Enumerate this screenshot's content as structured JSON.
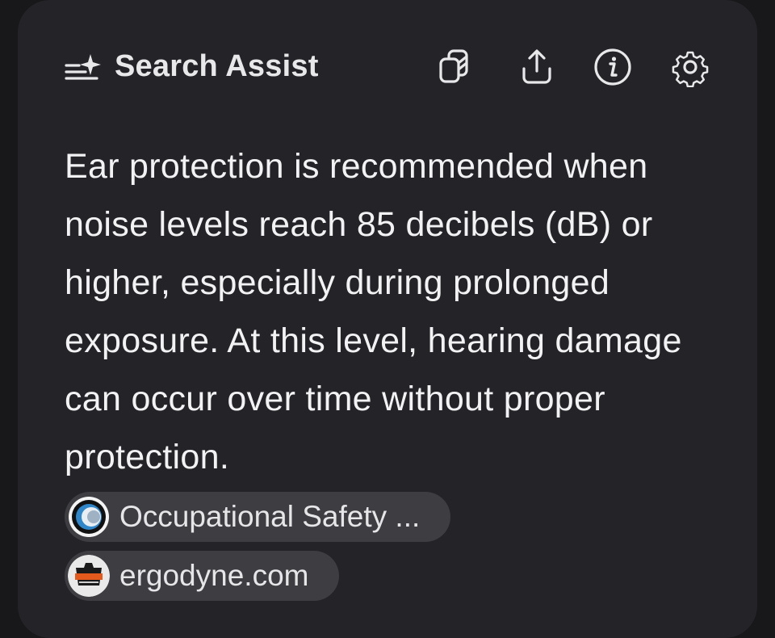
{
  "header": {
    "title": "Search Assist",
    "brand_icon": "sparkle-lines-icon",
    "actions": [
      {
        "name": "copy",
        "icon": "copy-icon"
      },
      {
        "name": "share",
        "icon": "share-icon"
      },
      {
        "name": "info",
        "icon": "info-icon"
      },
      {
        "name": "settings",
        "icon": "gear-icon"
      }
    ]
  },
  "answer": {
    "text": "Ear protection is recommended when noise levels reach 85 decibels (dB) or higher, especially during prolonged exposure. At this level, hearing damage can occur over time without proper protection."
  },
  "sources": [
    {
      "label": "Occupational Safety ...",
      "icon": "osha-logo-icon"
    },
    {
      "label": "ergodyne.com",
      "icon": "ergodyne-logo-icon"
    }
  ],
  "colors": {
    "background": "#18181a",
    "card": "#242428",
    "text": "#f2f2f4",
    "chip": "#3d3d42"
  }
}
